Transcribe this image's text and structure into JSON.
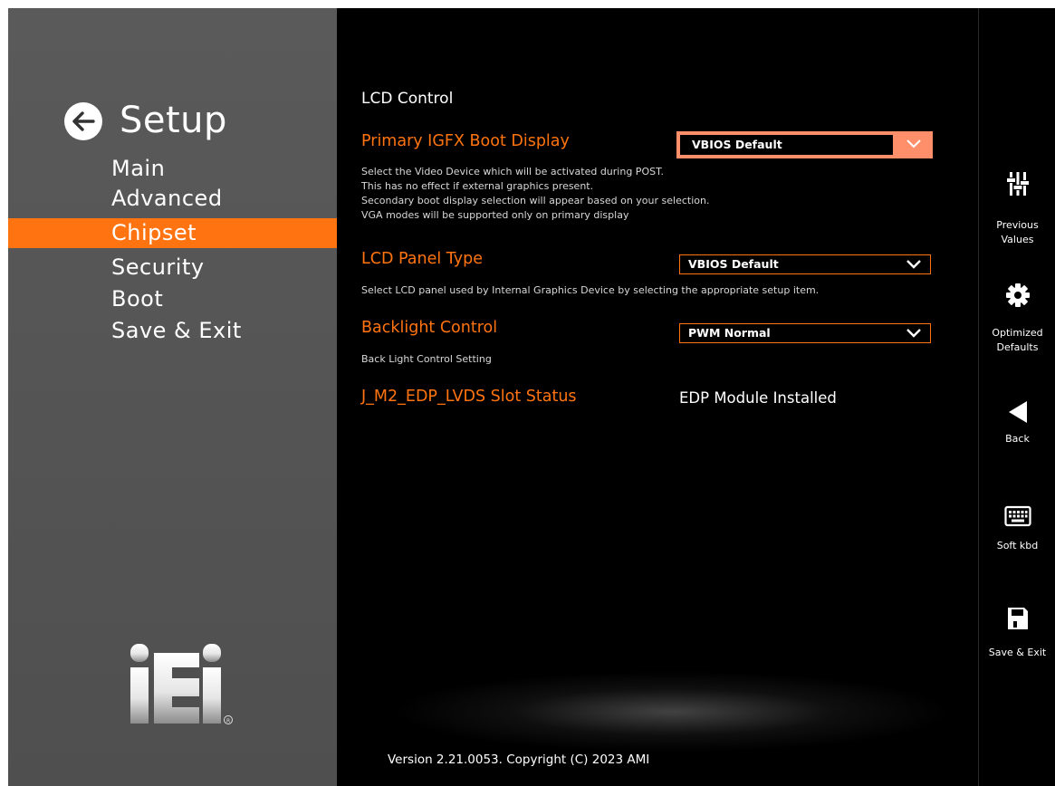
{
  "sidebar": {
    "title": "Setup",
    "items": [
      {
        "label": "Main",
        "active": false
      },
      {
        "label": "Advanced",
        "active": false
      },
      {
        "label": "Chipset",
        "active": true
      },
      {
        "label": "Security",
        "active": false
      },
      {
        "label": "Boot",
        "active": false
      },
      {
        "label": "Save & Exit",
        "active": false
      }
    ],
    "logo_text": "iEi"
  },
  "main": {
    "section_title": "LCD Control",
    "settings": [
      {
        "label": "Primary IGFX Boot Display",
        "value": "VBIOS Default",
        "help": [
          "Select the Video Device which will be activated during POST.",
          "This has no effect if external graphics present.",
          "Secondary boot display selection will appear based on your selection.",
          "VGA modes will be supported only on primary display"
        ]
      },
      {
        "label": "LCD Panel Type",
        "value": "VBIOS Default",
        "help": [
          "Select LCD panel used by Internal Graphics Device by selecting the appropriate setup item."
        ]
      },
      {
        "label": "Backlight Control",
        "value": "PWM Normal",
        "help": [
          "Back Light Control Setting"
        ]
      },
      {
        "label": "J_M2_EDP_LVDS Slot Status",
        "value": "EDP Module Installed"
      }
    ],
    "version": "Version 2.21.0053. Copyright (C) 2023 AMI"
  },
  "toolbar": {
    "items": [
      {
        "icon": "sliders-icon",
        "label_line1": "Previous",
        "label_line2": "Values"
      },
      {
        "icon": "gear-icon",
        "label_line1": "Optimized",
        "label_line2": "Defaults"
      },
      {
        "icon": "back-triangle-icon",
        "label_line1": "Back",
        "label_line2": ""
      },
      {
        "icon": "keyboard-icon",
        "label_line1": "Soft kbd",
        "label_line2": ""
      },
      {
        "icon": "save-disk-icon",
        "label_line1": "Save & Exit",
        "label_line2": ""
      }
    ]
  },
  "colors": {
    "accent": "#ff7410",
    "selected_dropdown": "#ff8f6b",
    "sidebar_bg": "#555555",
    "main_bg": "#000000"
  }
}
